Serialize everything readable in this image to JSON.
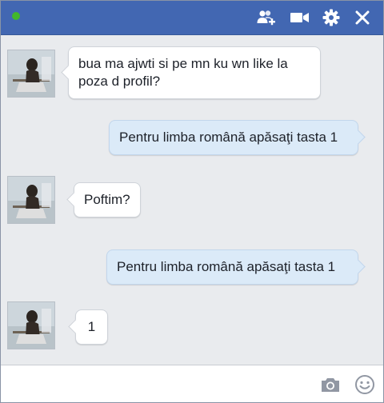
{
  "window": {
    "status": "online",
    "accent_color": "#4267b2",
    "online_color": "#42b72a"
  },
  "titlebar": {
    "icons": [
      "add-friend-icon",
      "video-call-icon",
      "gear-icon",
      "close-icon"
    ]
  },
  "messages": [
    {
      "direction": "incoming",
      "text": "bua ma ajwti si pe mn ku wn like la poza d profil?"
    },
    {
      "direction": "outgoing",
      "text": "Pentru limba română apăsaţi tasta 1"
    },
    {
      "direction": "incoming",
      "text": "Poftim?"
    },
    {
      "direction": "outgoing",
      "text": "Pentru limba română apăsaţi tasta 1"
    },
    {
      "direction": "incoming",
      "text": "1"
    }
  ],
  "composer": {
    "value": "",
    "icons": [
      "camera-icon",
      "emoji-icon"
    ]
  }
}
